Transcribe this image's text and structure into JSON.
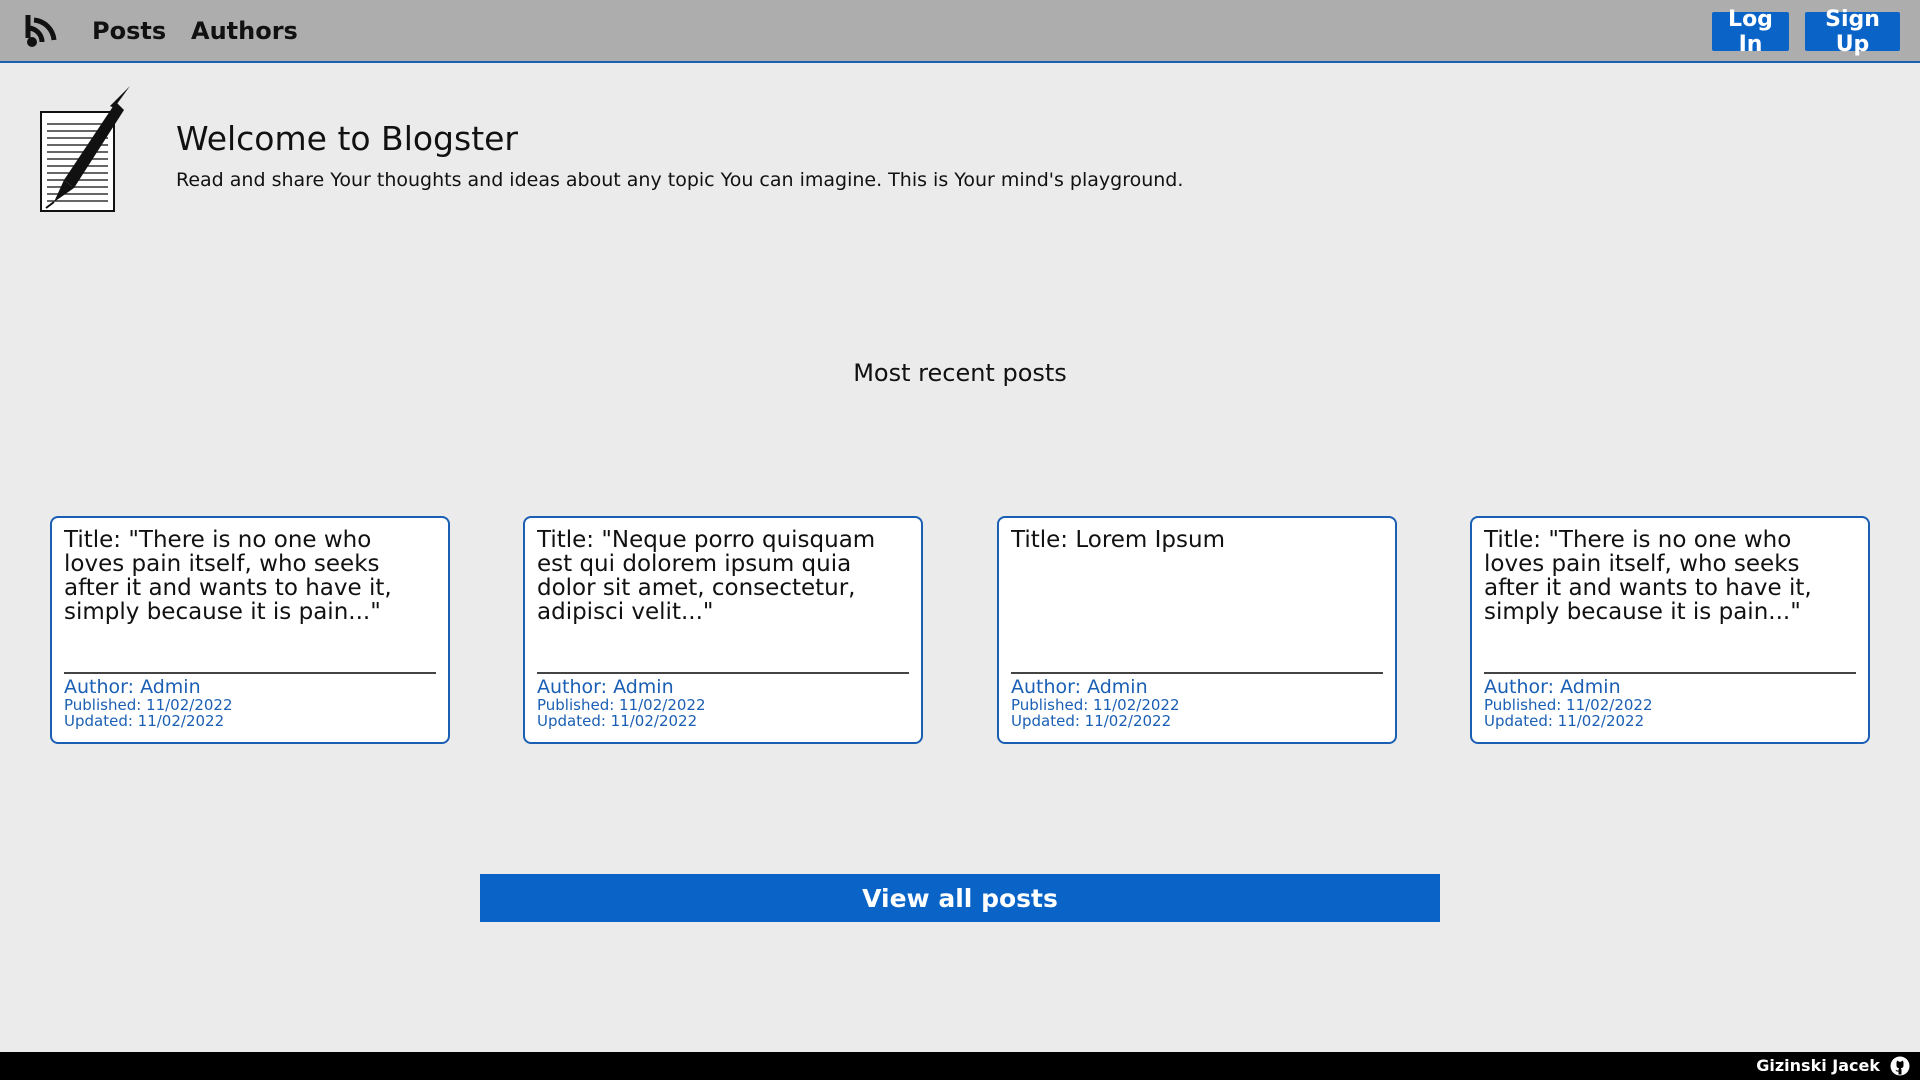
{
  "nav": {
    "logo_icon": "blog-feed-icon",
    "links": [
      "Posts",
      "Authors"
    ],
    "login_label": "Log In",
    "signup_label": "Sign Up"
  },
  "hero": {
    "image_icon": "paper-pen-icon",
    "title": "Welcome to Blogster",
    "subtitle": "Read and share Your thoughts and ideas about any topic You can imagine. This is Your mind's playground."
  },
  "recent": {
    "heading": "Most recent posts",
    "posts": [
      {
        "title": "Title: \"There is no one who loves pain itself, who seeks after it and wants to have it, simply because it is pain...\"",
        "author": "Author: Admin",
        "published": "Published: 11/02/2022",
        "updated": "Updated: 11/02/2022"
      },
      {
        "title": "Title: \"Neque porro quisquam est qui dolorem ipsum quia dolor sit amet, consectetur, adipisci velit...\"",
        "author": "Author: Admin",
        "published": "Published: 11/02/2022",
        "updated": "Updated: 11/02/2022"
      },
      {
        "title": "Title: Lorem Ipsum",
        "author": "Author: Admin",
        "published": "Published: 11/02/2022",
        "updated": "Updated: 11/02/2022"
      },
      {
        "title": "Title: \"There is no one who loves pain itself, who seeks after it and wants to have it, simply because it is pain...\"",
        "author": "Author: Admin",
        "published": "Published: 11/02/2022",
        "updated": "Updated: 11/02/2022"
      }
    ],
    "view_all_label": "View all posts"
  },
  "footer": {
    "name": "Gizinski Jacek",
    "github_icon": "github-icon"
  },
  "colors": {
    "accent": "#0a64c8",
    "link_blue": "#1a5fb4",
    "navbar_bg": "#adadad",
    "page_bg": "#ebebeb",
    "footer_bg": "#000000"
  }
}
